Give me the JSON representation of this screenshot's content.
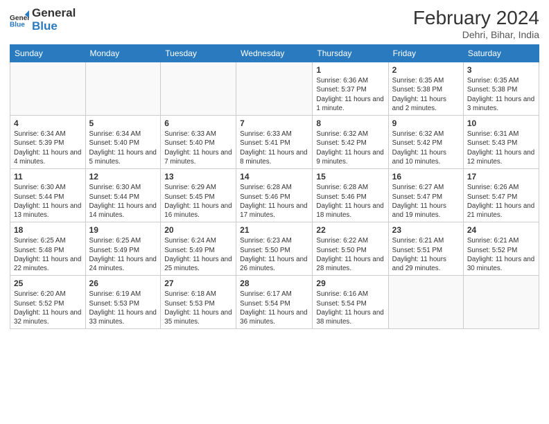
{
  "header": {
    "logo_general": "General",
    "logo_blue": "Blue",
    "month_year": "February 2024",
    "location": "Dehri, Bihar, India"
  },
  "days_of_week": [
    "Sunday",
    "Monday",
    "Tuesday",
    "Wednesday",
    "Thursday",
    "Friday",
    "Saturday"
  ],
  "weeks": [
    [
      {
        "day": "",
        "info": ""
      },
      {
        "day": "",
        "info": ""
      },
      {
        "day": "",
        "info": ""
      },
      {
        "day": "",
        "info": ""
      },
      {
        "day": "1",
        "info": "Sunrise: 6:36 AM\nSunset: 5:37 PM\nDaylight: 11 hours and 1 minute."
      },
      {
        "day": "2",
        "info": "Sunrise: 6:35 AM\nSunset: 5:38 PM\nDaylight: 11 hours and 2 minutes."
      },
      {
        "day": "3",
        "info": "Sunrise: 6:35 AM\nSunset: 5:38 PM\nDaylight: 11 hours and 3 minutes."
      }
    ],
    [
      {
        "day": "4",
        "info": "Sunrise: 6:34 AM\nSunset: 5:39 PM\nDaylight: 11 hours and 4 minutes."
      },
      {
        "day": "5",
        "info": "Sunrise: 6:34 AM\nSunset: 5:40 PM\nDaylight: 11 hours and 5 minutes."
      },
      {
        "day": "6",
        "info": "Sunrise: 6:33 AM\nSunset: 5:40 PM\nDaylight: 11 hours and 7 minutes."
      },
      {
        "day": "7",
        "info": "Sunrise: 6:33 AM\nSunset: 5:41 PM\nDaylight: 11 hours and 8 minutes."
      },
      {
        "day": "8",
        "info": "Sunrise: 6:32 AM\nSunset: 5:42 PM\nDaylight: 11 hours and 9 minutes."
      },
      {
        "day": "9",
        "info": "Sunrise: 6:32 AM\nSunset: 5:42 PM\nDaylight: 11 hours and 10 minutes."
      },
      {
        "day": "10",
        "info": "Sunrise: 6:31 AM\nSunset: 5:43 PM\nDaylight: 11 hours and 12 minutes."
      }
    ],
    [
      {
        "day": "11",
        "info": "Sunrise: 6:30 AM\nSunset: 5:44 PM\nDaylight: 11 hours and 13 minutes."
      },
      {
        "day": "12",
        "info": "Sunrise: 6:30 AM\nSunset: 5:44 PM\nDaylight: 11 hours and 14 minutes."
      },
      {
        "day": "13",
        "info": "Sunrise: 6:29 AM\nSunset: 5:45 PM\nDaylight: 11 hours and 16 minutes."
      },
      {
        "day": "14",
        "info": "Sunrise: 6:28 AM\nSunset: 5:46 PM\nDaylight: 11 hours and 17 minutes."
      },
      {
        "day": "15",
        "info": "Sunrise: 6:28 AM\nSunset: 5:46 PM\nDaylight: 11 hours and 18 minutes."
      },
      {
        "day": "16",
        "info": "Sunrise: 6:27 AM\nSunset: 5:47 PM\nDaylight: 11 hours and 19 minutes."
      },
      {
        "day": "17",
        "info": "Sunrise: 6:26 AM\nSunset: 5:47 PM\nDaylight: 11 hours and 21 minutes."
      }
    ],
    [
      {
        "day": "18",
        "info": "Sunrise: 6:25 AM\nSunset: 5:48 PM\nDaylight: 11 hours and 22 minutes."
      },
      {
        "day": "19",
        "info": "Sunrise: 6:25 AM\nSunset: 5:49 PM\nDaylight: 11 hours and 24 minutes."
      },
      {
        "day": "20",
        "info": "Sunrise: 6:24 AM\nSunset: 5:49 PM\nDaylight: 11 hours and 25 minutes."
      },
      {
        "day": "21",
        "info": "Sunrise: 6:23 AM\nSunset: 5:50 PM\nDaylight: 11 hours and 26 minutes."
      },
      {
        "day": "22",
        "info": "Sunrise: 6:22 AM\nSunset: 5:50 PM\nDaylight: 11 hours and 28 minutes."
      },
      {
        "day": "23",
        "info": "Sunrise: 6:21 AM\nSunset: 5:51 PM\nDaylight: 11 hours and 29 minutes."
      },
      {
        "day": "24",
        "info": "Sunrise: 6:21 AM\nSunset: 5:52 PM\nDaylight: 11 hours and 30 minutes."
      }
    ],
    [
      {
        "day": "25",
        "info": "Sunrise: 6:20 AM\nSunset: 5:52 PM\nDaylight: 11 hours and 32 minutes."
      },
      {
        "day": "26",
        "info": "Sunrise: 6:19 AM\nSunset: 5:53 PM\nDaylight: 11 hours and 33 minutes."
      },
      {
        "day": "27",
        "info": "Sunrise: 6:18 AM\nSunset: 5:53 PM\nDaylight: 11 hours and 35 minutes."
      },
      {
        "day": "28",
        "info": "Sunrise: 6:17 AM\nSunset: 5:54 PM\nDaylight: 11 hours and 36 minutes."
      },
      {
        "day": "29",
        "info": "Sunrise: 6:16 AM\nSunset: 5:54 PM\nDaylight: 11 hours and 38 minutes."
      },
      {
        "day": "",
        "info": ""
      },
      {
        "day": "",
        "info": ""
      }
    ]
  ]
}
